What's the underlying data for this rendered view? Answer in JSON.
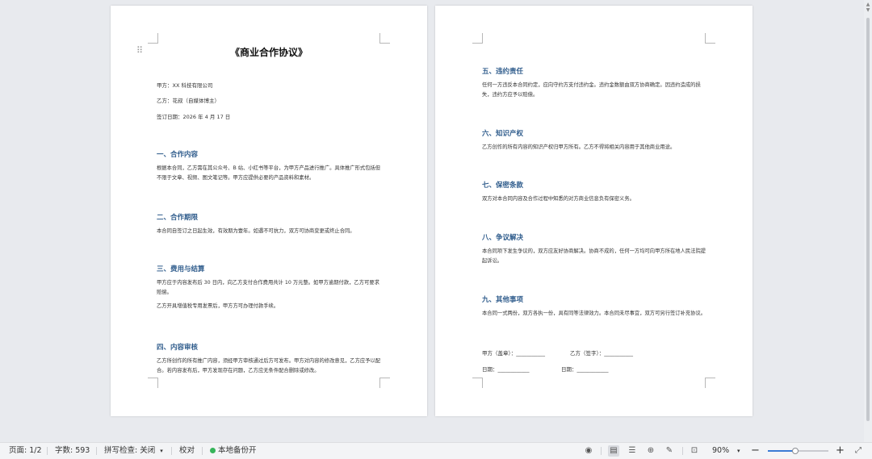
{
  "document": {
    "title": "《商业合作协议》",
    "party_a": "甲方：XX 科技有限公司",
    "party_b": "乙方：花叔（自媒体博主）",
    "sign_date": "签订日期：2026 年 4 月 17 日",
    "sections": [
      {
        "heading": "一、合作内容",
        "paragraphs": [
          "根据本合同，乙方需在其公众号、B 站、小红书等平台，为甲方产品进行推广。具体推广形式包括但不限于文章、视频、图文笔记等。甲方应提供必要的产品资料和素材。"
        ]
      },
      {
        "heading": "二、合作期限",
        "paragraphs": [
          "本合同自签订之日起生效，有效期为壹年。如遇不可抗力，双方可协商变更或终止合同。"
        ]
      },
      {
        "heading": "三、费用与结算",
        "paragraphs": [
          "甲方应于内容发布后 30 日内，向乙方支付合作费用共计 10 万元整。如甲方逾期付款，乙方可要求赔偿。",
          "乙方开具增值税专用发票后，甲方方可办理付款手续。"
        ]
      },
      {
        "heading": "四、内容审核",
        "paragraphs": [
          "乙方所创作的所有推广内容，须经甲方审核通过后方可发布。甲方对内容的修改意见，乙方应予以配合。若内容发布后，甲方发现存在问题，乙方应无条件配合删除或修改。"
        ]
      },
      {
        "heading": "五、违约责任",
        "paragraphs": [
          "任何一方违反本合同约定，应向守约方支付违约金。违约金数额由双方协商确定。因违约造成的损失，违约方应予以赔偿。"
        ]
      },
      {
        "heading": "六、知识产权",
        "paragraphs": [
          "乙方创作的所有内容的知识产权归甲方所有。乙方不得将相关内容用于其他商业用途。"
        ]
      },
      {
        "heading": "七、保密条款",
        "paragraphs": [
          "双方对本合同内容及合作过程中知悉的对方商业信息负有保密义务。"
        ]
      },
      {
        "heading": "八、争议解决",
        "paragraphs": [
          "本合同项下发生争议的，双方应友好协商解决。协商不成的，任何一方均可向甲方所在地人民法院提起诉讼。"
        ]
      },
      {
        "heading": "九、其他事项",
        "paragraphs": [
          "本合同一式两份，双方各执一份，具有同等法律效力。本合同未尽事宜，双方可另行签订补充协议。"
        ]
      }
    ],
    "signature": {
      "party_a_seal": "甲方（盖章）：___________",
      "party_b_sign": "乙方（签字）：___________",
      "date_a": "日期：____________",
      "date_b": "日期：____________"
    }
  },
  "statusbar": {
    "page": "页面: 1/2",
    "word_count": "字数: 593",
    "spell_check": "拼写检查: 关闭",
    "proofread": "校对",
    "backup": "本地备份开",
    "zoom_level": "90%",
    "zoom_fraction": 0.45
  },
  "colors": {
    "heading": "#2f5c8c",
    "backup_dot": "#36b45a"
  }
}
